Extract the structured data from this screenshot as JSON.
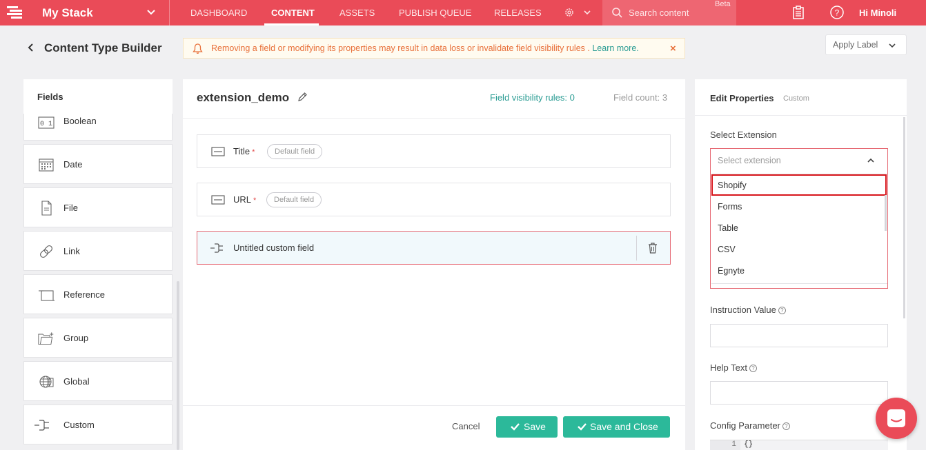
{
  "topnav": {
    "stack_name": "My Stack",
    "nav_items": [
      {
        "label": "DASHBOARD",
        "active": false
      },
      {
        "label": "CONTENT",
        "active": true
      },
      {
        "label": "ASSETS",
        "active": false
      },
      {
        "label": "PUBLISH QUEUE",
        "active": false
      },
      {
        "label": "RELEASES",
        "active": false
      }
    ],
    "search_placeholder": "Search content",
    "beta": "Beta",
    "greeting": "Hi Minoli",
    "accent_color": "#ea4b58"
  },
  "header": {
    "title": "Content Type Builder",
    "warning_text": "Removing a field or modifying its properties may result in data loss or invalidate field visibility rules .",
    "warning_link": "Learn more.",
    "warning_close": "×",
    "apply_label": "Apply Label"
  },
  "fields_panel": {
    "title": "Fields",
    "items": [
      {
        "label": "Boolean",
        "icon": "boolean-icon"
      },
      {
        "label": "Date",
        "icon": "calendar-icon"
      },
      {
        "label": "File",
        "icon": "file-icon"
      },
      {
        "label": "Link",
        "icon": "link-icon"
      },
      {
        "label": "Reference",
        "icon": "reference-icon"
      },
      {
        "label": "Group",
        "icon": "folder-plus-icon"
      },
      {
        "label": "Global",
        "icon": "globe-icon"
      },
      {
        "label": "Custom",
        "icon": "plug-icon"
      }
    ]
  },
  "content_type": {
    "name": "extension_demo",
    "visibility_rules": "Field visibility rules: 0",
    "field_count": "Field count: 3",
    "fields": [
      {
        "label": "Title",
        "required": "*",
        "badge": "Default field"
      },
      {
        "label": "URL",
        "required": "*",
        "badge": "Default field"
      },
      {
        "label": "Untitled custom field",
        "required": "",
        "badge": ""
      }
    ],
    "cancel": "Cancel",
    "save": "Save",
    "save_close": "Save and Close"
  },
  "properties": {
    "title": "Edit Properties",
    "subtitle": "Custom",
    "select_extension_label": "Select Extension",
    "select_placeholder": "Select extension",
    "extension_options": [
      "Shopify",
      "Forms",
      "Table",
      "CSV",
      "Egnyte"
    ],
    "highlighted_option": "Shopify",
    "instruction_label": "Instruction Value",
    "help_label": "Help Text",
    "config_label": "Config Parameter",
    "code_line_number": "1",
    "code_value": "{}"
  }
}
